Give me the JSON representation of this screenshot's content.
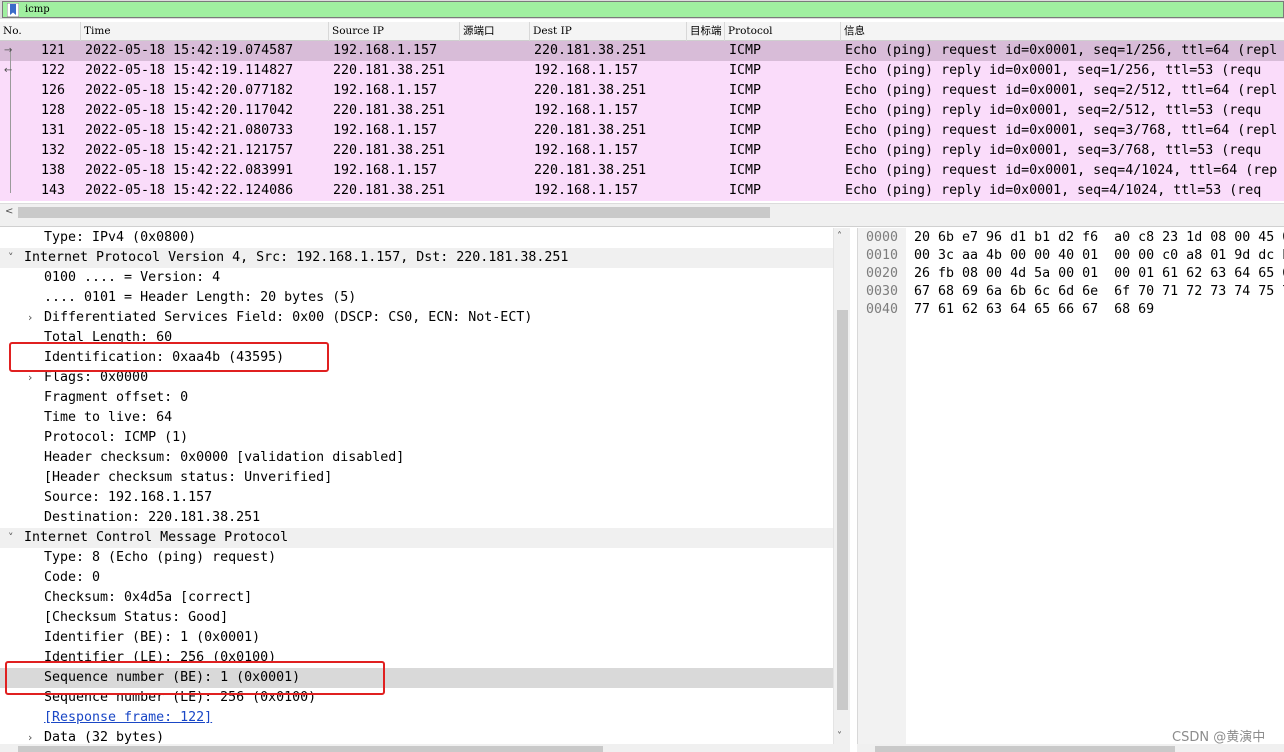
{
  "filter": {
    "text": "icmp",
    "bookmark_icon": "bookmark-icon"
  },
  "packet_list": {
    "columns": [
      "No.",
      "Time",
      "Source IP",
      "源端口",
      "Dest IP",
      "目标端",
      "Protocol",
      "信息"
    ],
    "rows": [
      {
        "no": "121",
        "time": "2022-05-18 15:42:19.074587",
        "src": "192.168.1.157",
        "dst": "220.181.38.251",
        "proto": "ICMP",
        "info": "Echo (ping) request  id=0x0001, seq=1/256, ttl=64 (repl"
      },
      {
        "no": "122",
        "time": "2022-05-18 15:42:19.114827",
        "src": "220.181.38.251",
        "dst": "192.168.1.157",
        "proto": "ICMP",
        "info": "Echo (ping) reply    id=0x0001, seq=1/256, ttl=53 (requ"
      },
      {
        "no": "126",
        "time": "2022-05-18 15:42:20.077182",
        "src": "192.168.1.157",
        "dst": "220.181.38.251",
        "proto": "ICMP",
        "info": "Echo (ping) request  id=0x0001, seq=2/512, ttl=64 (repl"
      },
      {
        "no": "128",
        "time": "2022-05-18 15:42:20.117042",
        "src": "220.181.38.251",
        "dst": "192.168.1.157",
        "proto": "ICMP",
        "info": "Echo (ping) reply    id=0x0001, seq=2/512, ttl=53 (requ"
      },
      {
        "no": "131",
        "time": "2022-05-18 15:42:21.080733",
        "src": "192.168.1.157",
        "dst": "220.181.38.251",
        "proto": "ICMP",
        "info": "Echo (ping) request  id=0x0001, seq=3/768, ttl=64 (repl"
      },
      {
        "no": "132",
        "time": "2022-05-18 15:42:21.121757",
        "src": "220.181.38.251",
        "dst": "192.168.1.157",
        "proto": "ICMP",
        "info": "Echo (ping) reply    id=0x0001, seq=3/768, ttl=53 (requ"
      },
      {
        "no": "138",
        "time": "2022-05-18 15:42:22.083991",
        "src": "192.168.1.157",
        "dst": "220.181.38.251",
        "proto": "ICMP",
        "info": "Echo (ping) request  id=0x0001, seq=4/1024, ttl=64 (rep"
      },
      {
        "no": "143",
        "time": "2022-05-18 15:42:22.124086",
        "src": "220.181.38.251",
        "dst": "192.168.1.157",
        "proto": "ICMP",
        "info": "Echo (ping) reply    id=0x0001, seq=4/1024, ttl=53 (req"
      }
    ]
  },
  "detail": {
    "lines": [
      {
        "text": "Type: IPv4 (0x0800)"
      },
      {
        "text": "Internet Protocol Version 4, Src: 192.168.1.157, Dst: 220.181.38.251",
        "header": true,
        "expander": "˅"
      },
      {
        "text": "0100 .... = Version: 4"
      },
      {
        "text": ".... 0101 = Header Length: 20 bytes (5)"
      },
      {
        "text": "Differentiated Services Field: 0x00 (DSCP: CS0, ECN: Not-ECT)",
        "expander": "›"
      },
      {
        "text": "Total Length: 60"
      },
      {
        "text": "Identification: 0xaa4b (43595)"
      },
      {
        "text": "Flags: 0x0000",
        "expander": "›"
      },
      {
        "text": "Fragment offset: 0"
      },
      {
        "text": "Time to live: 64"
      },
      {
        "text": "Protocol: ICMP (1)"
      },
      {
        "text": "Header checksum: 0x0000 [validation disabled]"
      },
      {
        "text": "[Header checksum status: Unverified]"
      },
      {
        "text": "Source: 192.168.1.157"
      },
      {
        "text": "Destination: 220.181.38.251"
      },
      {
        "text": "Internet Control Message Protocol",
        "header": true,
        "expander": "˅"
      },
      {
        "text": "Type: 8 (Echo (ping) request)"
      },
      {
        "text": "Code: 0"
      },
      {
        "text": "Checksum: 0x4d5a [correct]"
      },
      {
        "text": "[Checksum Status: Good]"
      },
      {
        "text": "Identifier (BE): 1 (0x0001)"
      },
      {
        "text": "Identifier (LE): 256 (0x0100)"
      },
      {
        "text": "Sequence number (BE): 1 (0x0001)",
        "highlight": true
      },
      {
        "text": "Sequence number (LE): 256 (0x0100)"
      },
      {
        "text": "[Response frame: 122]",
        "link": true
      },
      {
        "text": "Data (32 bytes)",
        "expander": "›"
      }
    ]
  },
  "bytes": {
    "rows": [
      {
        "offset": "0000",
        "hex": "20 6b e7 96 d1 b1 d2 f6  a0 c8 23 1d 08 00 45 0"
      },
      {
        "offset": "0010",
        "hex": "00 3c aa 4b 00 00 40 01  00 00 c0 a8 01 9d dc b"
      },
      {
        "offset": "0020",
        "hex": "26 fb 08 00 4d 5a 00 01  00 01 61 62 63 64 65 6"
      },
      {
        "offset": "0030",
        "hex": "67 68 69 6a 6b 6c 6d 6e  6f 70 71 72 73 74 75 7"
      },
      {
        "offset": "0040",
        "hex": "77 61 62 63 64 65 66 67  68 69"
      }
    ]
  },
  "watermark": "CSDN @黄演中",
  "colors": {
    "filter_bg": "#a0f0a0",
    "row_bg": "#fadcfa",
    "row_selected": "#d8bcd8",
    "annotation": "#e02020"
  }
}
